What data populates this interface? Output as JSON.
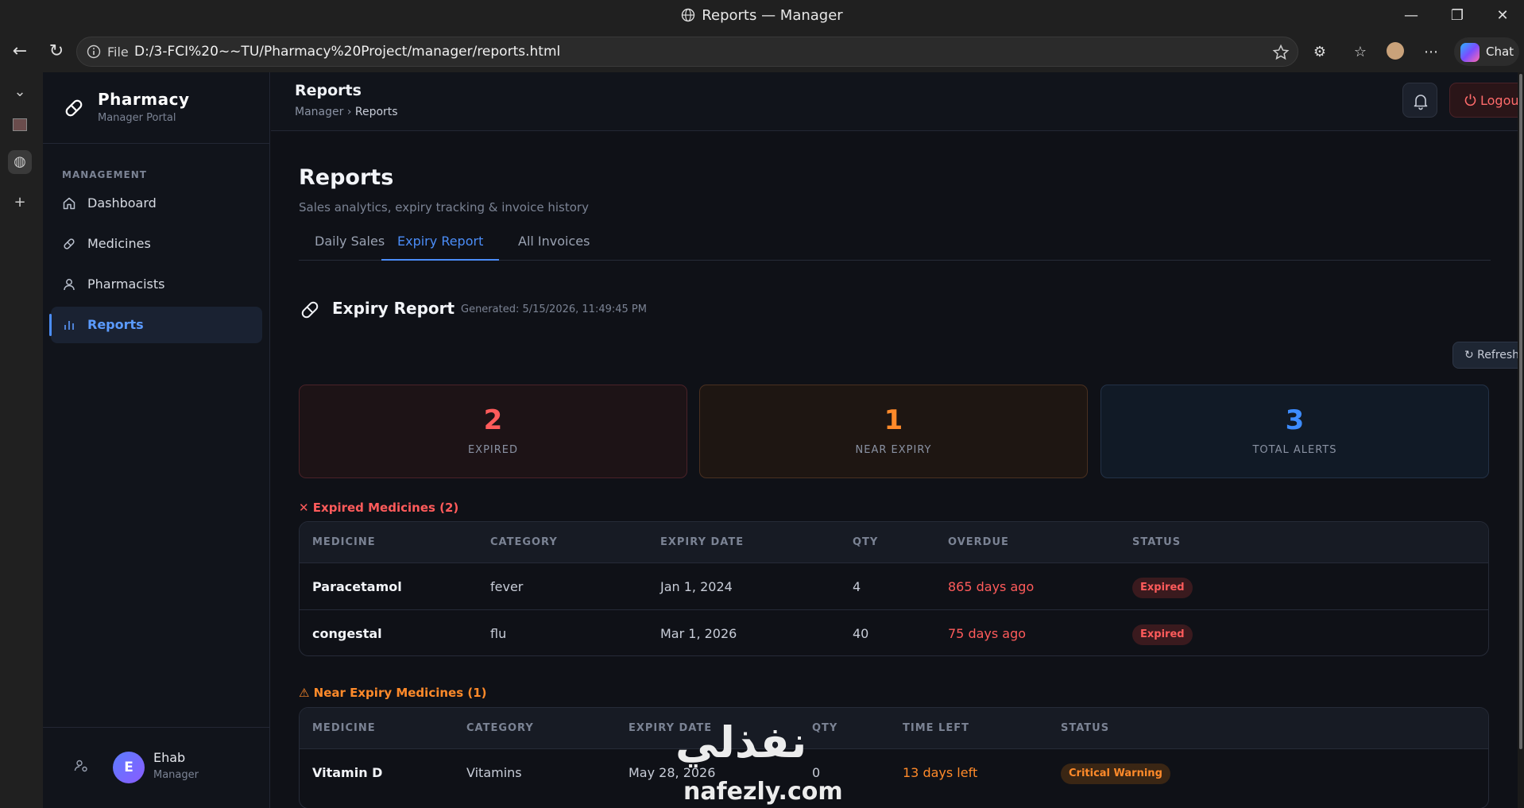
{
  "browser": {
    "window_title": "Reports — Manager",
    "address_prefix": "File",
    "url": "D:/3-FCI%20~~TU/Pharmacy%20Project/manager/reports.html",
    "chat_label": "Chat"
  },
  "sidebar": {
    "brand_name": "Pharmacy",
    "brand_sub": "Manager Portal",
    "section_label": "MANAGEMENT",
    "items": [
      {
        "label": "Dashboard",
        "icon": "home-icon"
      },
      {
        "label": "Medicines",
        "icon": "pill-icon"
      },
      {
        "label": "Pharmacists",
        "icon": "user-icon"
      },
      {
        "label": "Reports",
        "icon": "bar-chart-icon",
        "active": true
      }
    ],
    "user": {
      "initial": "E",
      "name": "Ehab",
      "role": "Manager"
    }
  },
  "header": {
    "title": "Reports",
    "breadcrumb_root": "Manager",
    "breadcrumb_sep": "›",
    "breadcrumb_current": "Reports",
    "logout_label": "Logout"
  },
  "page": {
    "title": "Reports",
    "subtitle": "Sales analytics, expiry tracking & invoice history",
    "tabs": [
      {
        "label": "Daily Sales"
      },
      {
        "label": "Expiry Report",
        "active": true
      },
      {
        "label": "All Invoices"
      }
    ],
    "report_title": "Expiry Report",
    "generated": "Generated: 5/15/2026, 11:49:45 PM",
    "refresh_label": "↻ Refresh"
  },
  "stats": [
    {
      "value": "2",
      "label": "EXPIRED",
      "color": "#ff5b5b"
    },
    {
      "value": "1",
      "label": "NEAR EXPIRY",
      "color": "#ff8a2a"
    },
    {
      "value": "3",
      "label": "TOTAL ALERTS",
      "color": "#3d8cff"
    }
  ],
  "expired": {
    "title": "✕ Expired Medicines (2)",
    "headers": [
      "MEDICINE",
      "CATEGORY",
      "EXPIRY DATE",
      "QTY",
      "OVERDUE",
      "STATUS"
    ],
    "rows": [
      {
        "medicine": "Paracetamol",
        "category": "fever",
        "expiry": "Jan 1, 2024",
        "qty": "4",
        "overdue": "865 days ago",
        "status": "Expired"
      },
      {
        "medicine": "congestal",
        "category": "flu",
        "expiry": "Mar 1, 2026",
        "qty": "40",
        "overdue": "75 days ago",
        "status": "Expired"
      }
    ]
  },
  "near_expiry": {
    "title": "⚠ Near Expiry Medicines (1)",
    "headers": [
      "MEDICINE",
      "CATEGORY",
      "EXPIRY DATE",
      "QTY",
      "TIME LEFT",
      "STATUS"
    ],
    "rows": [
      {
        "medicine": "Vitamin D",
        "category": "Vitamins",
        "expiry": "May 28, 2026",
        "qty": "0",
        "time_left": "13 days left",
        "status": "Critical Warning"
      }
    ]
  },
  "watermark": {
    "arabic": "نفذلي",
    "latin": "nafezly.com"
  }
}
